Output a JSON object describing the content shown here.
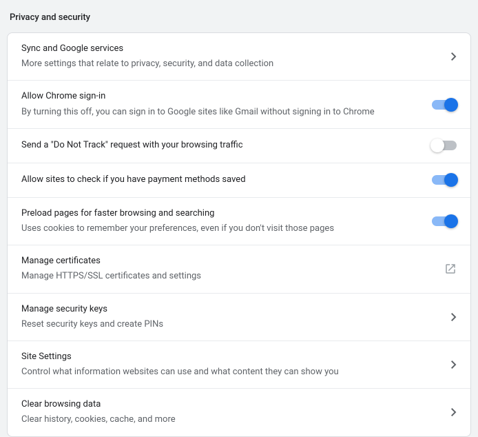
{
  "section_title": "Privacy and security",
  "rows": [
    {
      "id": "sync-services",
      "title": "Sync and Google services",
      "subtitle": "More settings that relate to privacy, security, and data collection",
      "action": "chevron"
    },
    {
      "id": "allow-sign-in",
      "title": "Allow Chrome sign-in",
      "subtitle": "By turning this off, you can sign in to Google sites like Gmail without signing in to Chrome",
      "action": "toggle",
      "toggled": true
    },
    {
      "id": "do-not-track",
      "title": "Send a \"Do Not Track\" request with your browsing traffic",
      "subtitle": null,
      "action": "toggle",
      "toggled": false
    },
    {
      "id": "payment-methods",
      "title": "Allow sites to check if you have payment methods saved",
      "subtitle": null,
      "action": "toggle",
      "toggled": true
    },
    {
      "id": "preload-pages",
      "title": "Preload pages for faster browsing and searching",
      "subtitle": "Uses cookies to remember your preferences, even if you don't visit those pages",
      "action": "toggle",
      "toggled": true
    },
    {
      "id": "manage-certificates",
      "title": "Manage certificates",
      "subtitle": "Manage HTTPS/SSL certificates and settings",
      "action": "external"
    },
    {
      "id": "manage-security-keys",
      "title": "Manage security keys",
      "subtitle": "Reset security keys and create PINs",
      "action": "chevron"
    },
    {
      "id": "site-settings",
      "title": "Site Settings",
      "subtitle": "Control what information websites can use and what content they can show you",
      "action": "chevron"
    },
    {
      "id": "clear-browsing-data",
      "title": "Clear browsing data",
      "subtitle": "Clear history, cookies, cache, and more",
      "action": "chevron"
    }
  ]
}
